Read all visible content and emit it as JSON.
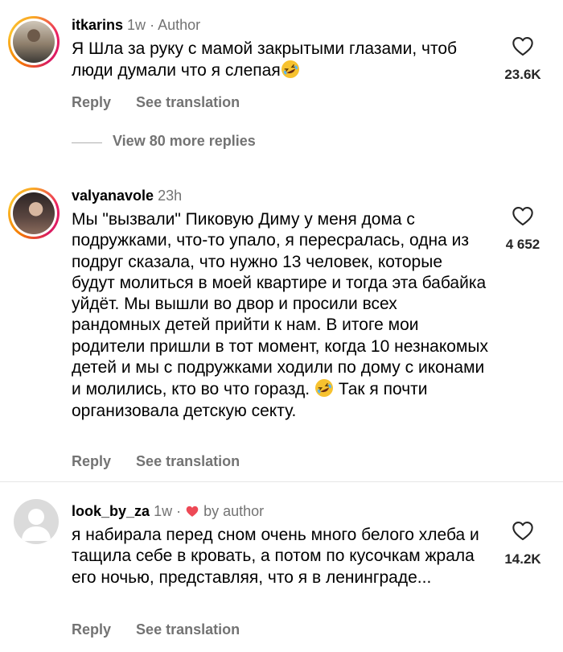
{
  "comments": [
    {
      "username": "itkarins",
      "time": "1w",
      "separator": "·",
      "badge": "Author",
      "text_before": "Я Шла за руку с мамой закрытыми глазами, чтоб люди думали что я слепая",
      "text_after": "",
      "emoji": "rolling-on-floor-laughing",
      "likes": "23.6K",
      "reply_label": "Reply",
      "translate_label": "See translation",
      "view_replies": "View 80 more replies"
    },
    {
      "username": "valyanavole",
      "time": "23h",
      "text_before": "Мы \"вызвали\" Пиковую Диму у меня дома с подружками, что-то упало, я пересралась, одна из подруг сказала, что нужно 13 человек, которые будут молиться в моей квартире и тогда эта бабайка уйдёт. Мы вышли во двор и просили всех рандомных детей прийти к нам. В итоге мои родители пришли в тот момент, когда 10 незнакомых детей и мы с подружками ходили по дому с иконами и молились, кто во что горазд.",
      "text_after": " Так я почти организовала детскую секту.",
      "emoji": "rolling-on-floor-laughing",
      "likes": "4 652",
      "reply_label": "Reply",
      "translate_label": "See translation"
    },
    {
      "username": "look_by_za",
      "time": "1w",
      "separator": "·",
      "badge": "by author",
      "badge_icon": "heart-filled-icon",
      "badge_color": "#ed4956",
      "text_before": "я набирала перед сном очень много белого хлеба и тащила себе в кровать, а потом по кусочкам жрала его ночью, представляя, что я в ленинграде...",
      "text_after": "",
      "likes": "14.2K",
      "reply_label": "Reply",
      "translate_label": "See translation"
    }
  ],
  "colors": {
    "secondary": "#737373",
    "like_red": "#ed4956",
    "ring_start": "#f9a825",
    "ring_end": "#d81b60"
  }
}
